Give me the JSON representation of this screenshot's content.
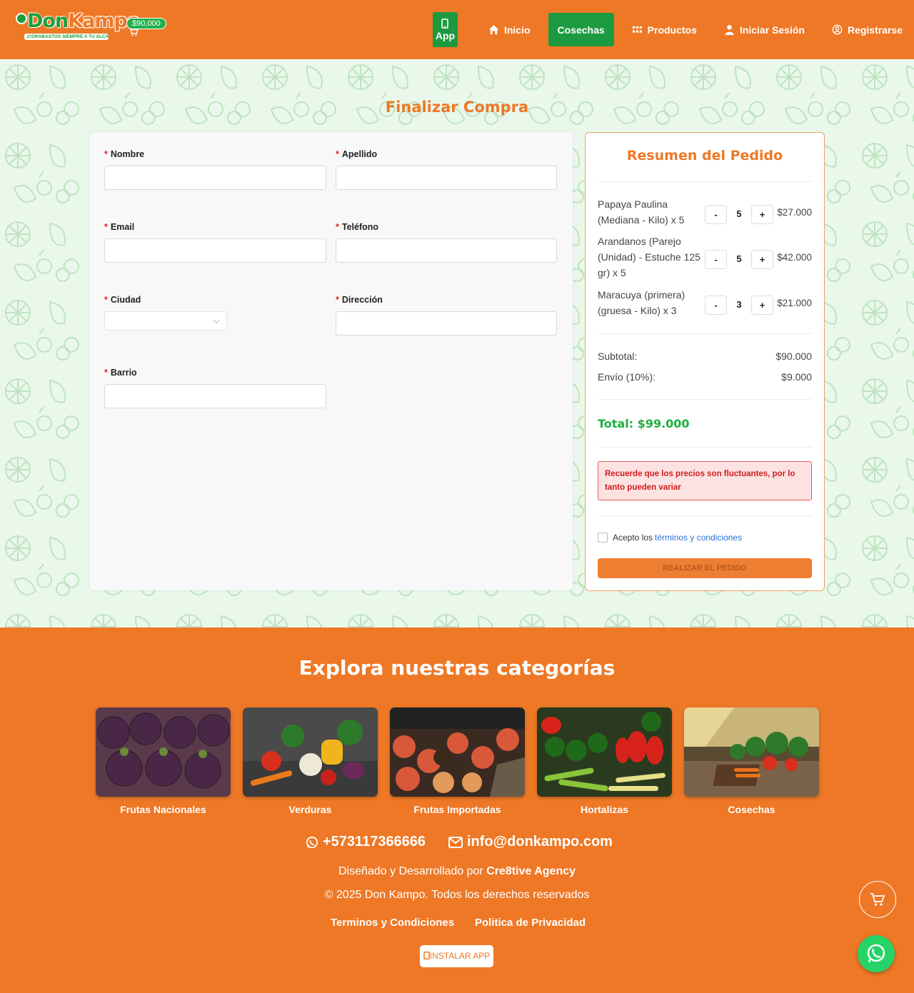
{
  "header": {
    "logo_text_a": "Don",
    "logo_text_b": "Kampo",
    "logo_tagline": "¡CORABASTOS SIEMPRE A TU ALCANCE!",
    "cart_total": "$90,000",
    "nav": {
      "app": "App",
      "inicio": "Inicio",
      "cosechas": "Cosechas",
      "productos": "Productos",
      "login": "Iniciar Sesión",
      "register": "Registrarse"
    }
  },
  "page": {
    "title": "Finalizar Compra"
  },
  "form": {
    "nombre": "Nombre",
    "apellido": "Apellido",
    "email": "Email",
    "telefono": "Teléfono",
    "ciudad": "Ciudad",
    "direccion": "Dirección",
    "barrio": "Barrio",
    "required_mark": "*"
  },
  "summary": {
    "title": "Resumen del Pedido",
    "items": [
      {
        "name": "Papaya Paulina (Mediana - Kilo) x 5",
        "qty": "5",
        "price": "$27.000"
      },
      {
        "name": "Arandanos (Parejo (Unidad) - Estuche 125 gr) x 5",
        "qty": "5",
        "price": "$42.000"
      },
      {
        "name": "Maracuya (primera) (gruesa - Kilo) x 3",
        "qty": "3",
        "price": "$21.000"
      }
    ],
    "minus": "-",
    "plus": "+",
    "subtotal_label": "Subtotal:",
    "subtotal_value": "$90.000",
    "shipping_label": "Envío (10%):",
    "shipping_value": "$9.000",
    "total": "Total: $99.000",
    "warning": "Recuerde que los precios son fluctuantes, por lo tanto pueden variar",
    "terms_prefix": "Acepto los",
    "terms_link": "términos y condiciones",
    "order_button": "REALIZAR EL PEDIDO"
  },
  "footer": {
    "title": "Explora nuestras categorías",
    "categories": [
      {
        "label": "Frutas Nacionales"
      },
      {
        "label": "Verduras"
      },
      {
        "label": "Frutas Importadas"
      },
      {
        "label": "Hortalizas"
      },
      {
        "label": "Cosechas"
      }
    ],
    "phone": "+573117366666",
    "email": "info@donkampo.com",
    "credit_prefix": "Diseñado y Desarrollado por",
    "credit_agency": "Cre8tive Agency",
    "copyright": "© 2025 Don Kampo. Todos los derechos reservados",
    "terms": "Terminos y Condiciones",
    "privacy": "Politica de Privacidad",
    "install": "INSTALAR APP"
  },
  "colors": {
    "brand_orange": "#ee7826",
    "brand_green": "#1d9a3f",
    "background_mint": "#e9f8ea"
  }
}
